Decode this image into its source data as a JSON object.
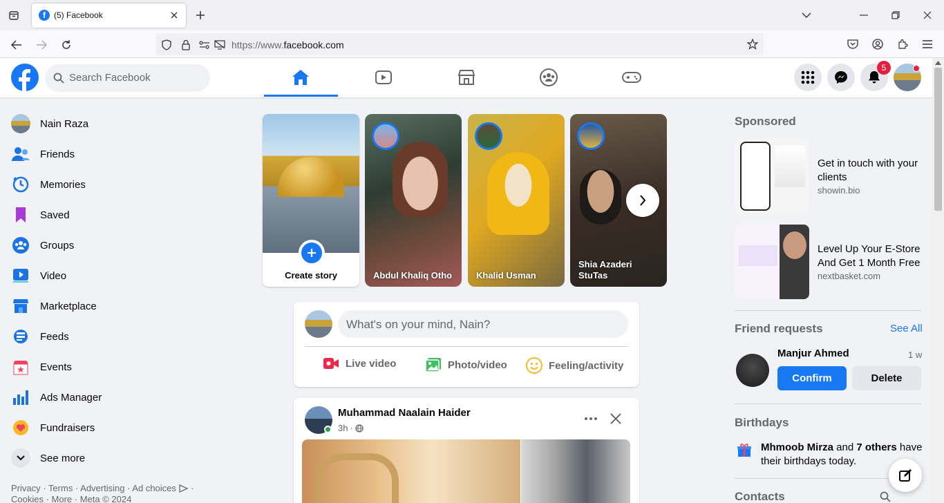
{
  "browser": {
    "tab_title": "(5) Facebook",
    "url_scheme": "https://www.",
    "url_host": "facebook.com"
  },
  "header": {
    "search_placeholder": "Search Facebook",
    "notification_count": "5"
  },
  "sidebar": {
    "items": [
      {
        "label": "Nain Raza",
        "icon": "profile-avatar"
      },
      {
        "label": "Friends",
        "icon": "friends-icon"
      },
      {
        "label": "Memories",
        "icon": "memories-icon"
      },
      {
        "label": "Saved",
        "icon": "saved-icon"
      },
      {
        "label": "Groups",
        "icon": "groups-icon"
      },
      {
        "label": "Video",
        "icon": "video-icon"
      },
      {
        "label": "Marketplace",
        "icon": "marketplace-icon"
      },
      {
        "label": "Feeds",
        "icon": "feeds-icon"
      },
      {
        "label": "Events",
        "icon": "events-icon"
      },
      {
        "label": "Ads Manager",
        "icon": "ads-manager-icon"
      },
      {
        "label": "Fundraisers",
        "icon": "fundraisers-icon"
      },
      {
        "label": "See more",
        "icon": "chevron-down-icon"
      }
    ],
    "footer_line1": "Privacy · Terms · Advertising · Ad choices",
    "footer_line2": "Cookies · More · Meta © 2024"
  },
  "stories": {
    "create_label": "Create story",
    "items": [
      {
        "name": "Abdul Khaliq Otho"
      },
      {
        "name": "Khalid Usman"
      },
      {
        "name": "Shia Azaderi StuTas"
      }
    ]
  },
  "composer": {
    "placeholder": "What's on your mind, Nain?",
    "live_label": "Live video",
    "photo_label": "Photo/video",
    "feeling_label": "Feeling/activity"
  },
  "post": {
    "author": "Muhammad Naalain Haider",
    "time": "3h"
  },
  "right": {
    "sponsored_title": "Sponsored",
    "ads": [
      {
        "title": "Get in touch with your clients",
        "domain": "showin.bio"
      },
      {
        "title": "Level Up Your E-Store And Get 1 Month Free",
        "domain": "nextbasket.com"
      }
    ],
    "friend_requests_title": "Friend requests",
    "see_all": "See All",
    "request": {
      "name": "Manjur Ahmed",
      "age": "1 w",
      "confirm": "Confirm",
      "delete": "Delete"
    },
    "birthdays_title": "Birthdays",
    "birthday_name": "Mhmoob Mirza",
    "birthday_and": " and ",
    "birthday_others": "7 others",
    "birthday_rest": " have their birthdays today.",
    "contacts_title": "Contacts"
  },
  "colors": {
    "brand": "#1877f2",
    "badge": "#e41e3f"
  }
}
